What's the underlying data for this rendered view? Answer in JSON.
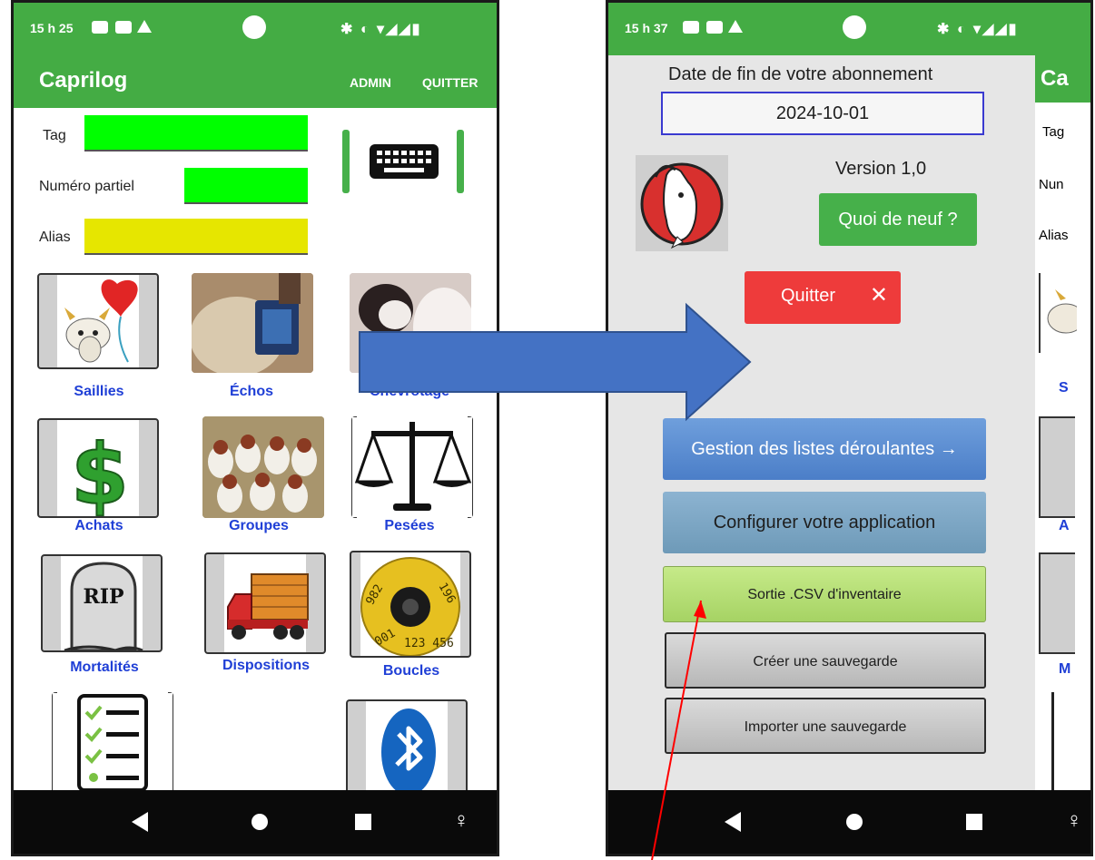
{
  "left": {
    "status": {
      "time": "15 h 25"
    },
    "appbar": {
      "title": "Caprilog",
      "admin": "ADMIN",
      "quit": "QUITTER"
    },
    "fields": {
      "tag_label": "Tag",
      "partial_label": "Numéro partiel",
      "alias_label": "Alias"
    },
    "tiles": [
      {
        "label": "Saillies"
      },
      {
        "label": "Échos"
      },
      {
        "label": "Chevrotage"
      },
      {
        "label": "Achats"
      },
      {
        "label": "Groupes"
      },
      {
        "label": "Pesées"
      },
      {
        "label": "Mortalités"
      },
      {
        "label": "Dispositions"
      },
      {
        "label": "Boucles"
      }
    ],
    "tombstone_text": "RIP",
    "tag_text": {
      "a": "982",
      "b": "001",
      "c": "123 456",
      "d": "196"
    }
  },
  "right": {
    "status": {
      "time": "15 h 37"
    },
    "subscription_label": "Date de fin de votre abonnement",
    "subscription_date": "2024-10-01",
    "version": "Version 1,0",
    "whats_new": "Quoi de neuf ?",
    "quit": "Quitter",
    "buttons": {
      "lists": "Gestion des listes déroulantes →",
      "configure": "Configurer votre application",
      "csv": "Sortie .CSV d'inventaire",
      "create_backup": "Créer une sauvegarde",
      "import_backup": "Importer une sauvegarde"
    },
    "peek": {
      "title": "Ca",
      "tag": "Tag",
      "num": "Nun",
      "alias": "Alias",
      "s": "S",
      "a": "A",
      "m": "M"
    }
  },
  "colors": {
    "green": "#44ac44",
    "field_green": "#00ff00",
    "field_yellow": "#e6e600",
    "arrow_blue": "#4472c4",
    "pointer_red": "#ff0000",
    "link_blue": "#1f3fd6"
  }
}
